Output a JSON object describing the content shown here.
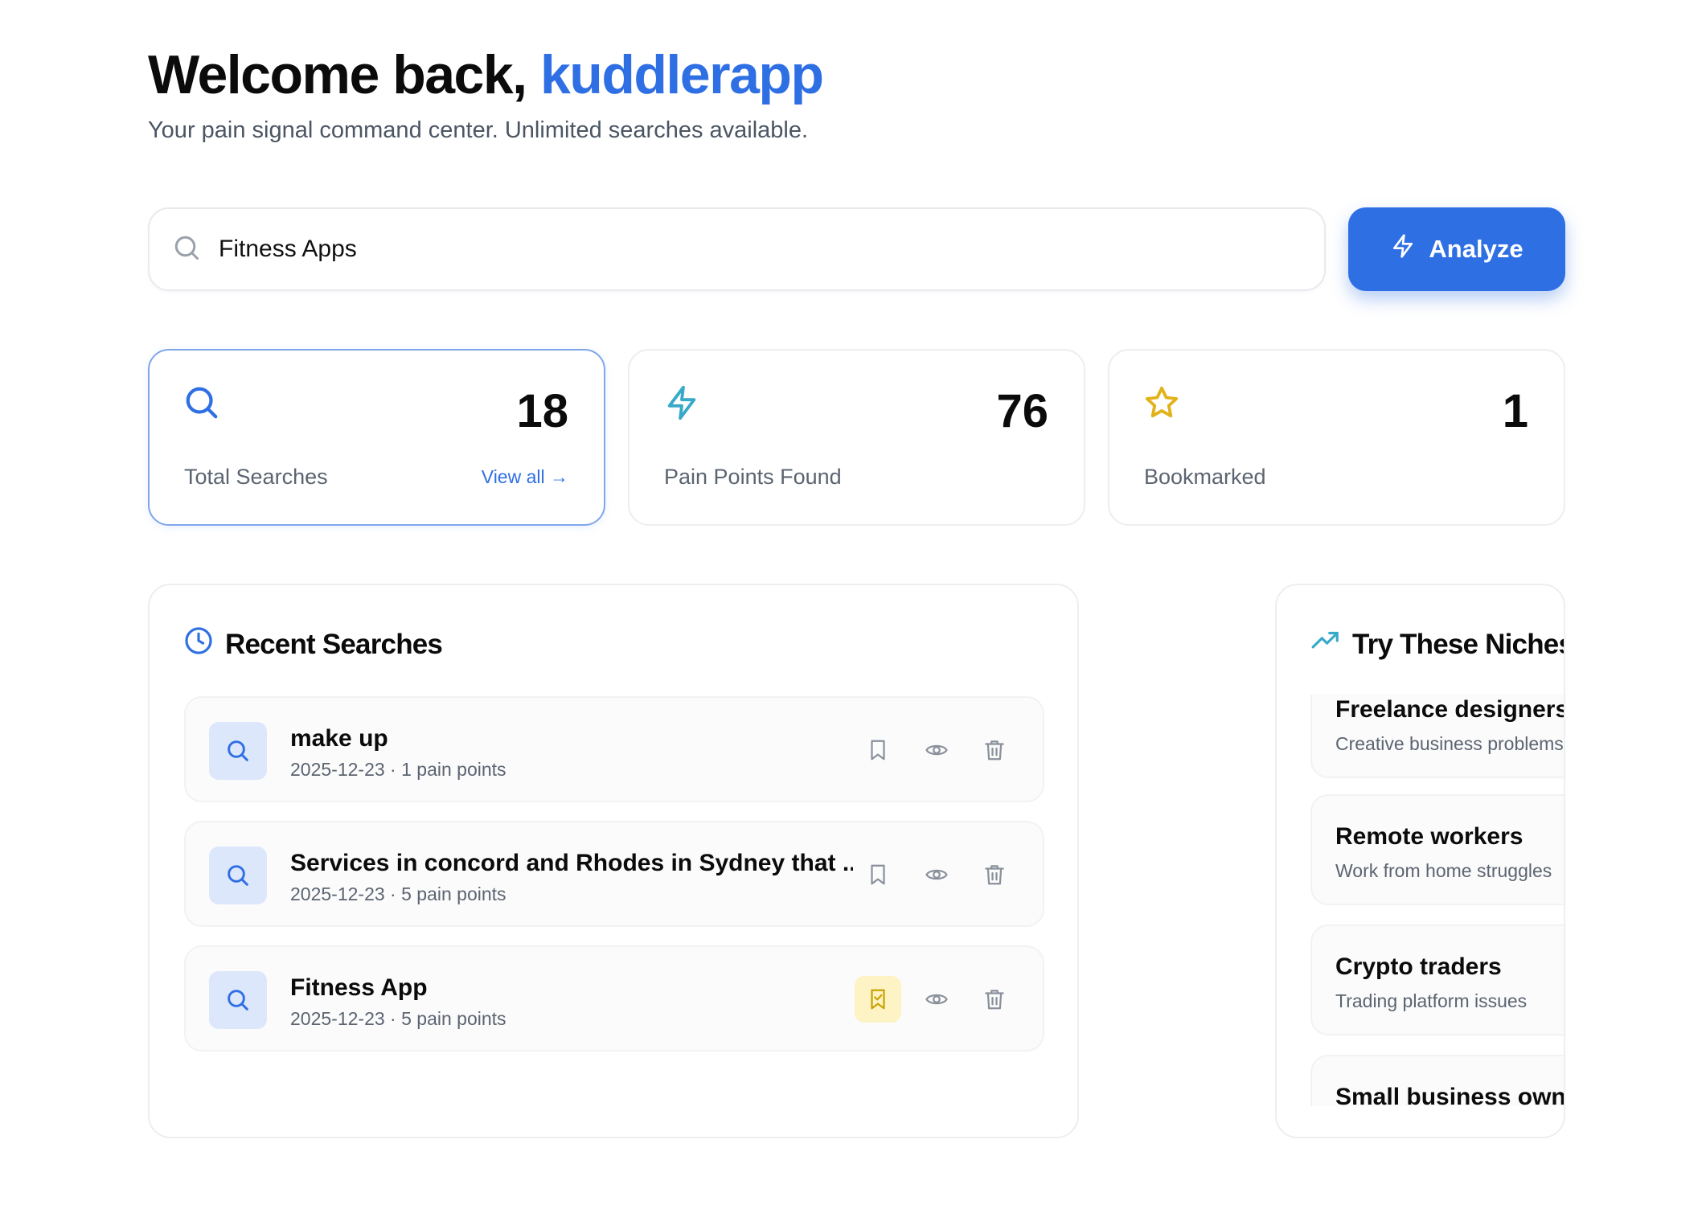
{
  "header": {
    "welcome_prefix": "Welcome back,",
    "username": "kuddlerapp",
    "subtitle": "Your pain signal command center. Unlimited searches available."
  },
  "search": {
    "value": "Fitness Apps",
    "icon": "search-icon",
    "button_label": "Analyze",
    "button_icon": "lightning-icon"
  },
  "stats": [
    {
      "icon": "search-icon",
      "value": "18",
      "label": "Total Searches",
      "link": "View all →",
      "color": "#2f6fe4"
    },
    {
      "icon": "lightning-icon",
      "value": "76",
      "label": "Pain Points Found",
      "color": "#37a9c9"
    },
    {
      "icon": "star-icon",
      "value": "1",
      "label": "Bookmarked",
      "color": "#e2b21a"
    }
  ],
  "recent": {
    "title": "Recent Searches",
    "icon": "clock-icon",
    "items": [
      {
        "title": "make up",
        "meta": "2025-12-23 · 1 pain points",
        "bookmarked": false
      },
      {
        "title": "Services in concord and Rhodes in Sydney that ...",
        "meta": "2025-12-23 · 5 pain points",
        "bookmarked": false
      },
      {
        "title": "Fitness App",
        "meta": "2025-12-23 · 5 pain points",
        "bookmarked": true
      }
    ]
  },
  "niches": {
    "title": "Try These Niches",
    "icon": "trending-up-icon",
    "items": [
      {
        "title": "Freelance designers",
        "subtitle": "Creative business problems"
      },
      {
        "title": "Remote workers",
        "subtitle": "Work from home struggles"
      },
      {
        "title": "Crypto traders",
        "subtitle": "Trading platform issues"
      },
      {
        "title": "Small business owners",
        "subtitle": ""
      }
    ]
  },
  "colors": {
    "accent": "#2f6fe4",
    "bookmark_active_bg": "#fdf3c4",
    "bookmark_active_icon": "#c9a200"
  }
}
